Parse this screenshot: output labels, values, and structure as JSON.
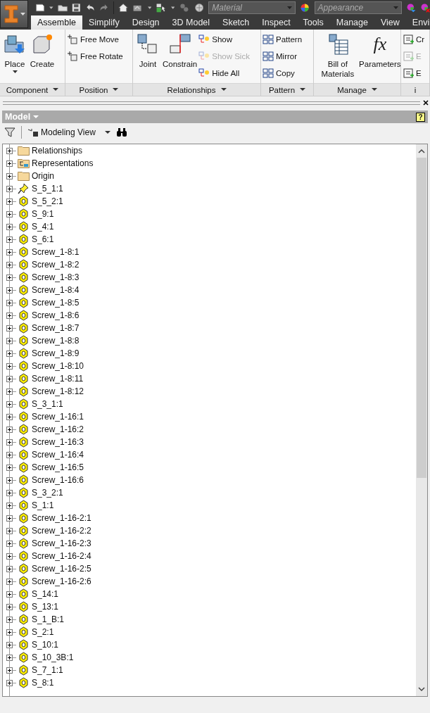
{
  "quick_access": {
    "material_placeholder": "Material",
    "appearance_placeholder": "Appearance"
  },
  "tabs": [
    {
      "label": "Assemble",
      "selected": true
    },
    {
      "label": "Simplify",
      "selected": false
    },
    {
      "label": "Design",
      "selected": false
    },
    {
      "label": "3D Model",
      "selected": false
    },
    {
      "label": "Sketch",
      "selected": false
    },
    {
      "label": "Inspect",
      "selected": false
    },
    {
      "label": "Tools",
      "selected": false
    },
    {
      "label": "Manage",
      "selected": false
    },
    {
      "label": "View",
      "selected": false
    },
    {
      "label": "Envi",
      "selected": false
    }
  ],
  "ribbon": {
    "panels": [
      {
        "label": "Component",
        "menu": true,
        "tools": [
          {
            "label": "Place",
            "kind": "split",
            "disabled": false
          },
          {
            "label": "Create",
            "kind": "large",
            "disabled": false
          }
        ]
      },
      {
        "label": "Position",
        "menu": true,
        "tools": [
          {
            "label": "Free Move",
            "kind": "small",
            "disabled": false
          },
          {
            "label": "Free Rotate",
            "kind": "small",
            "disabled": false
          }
        ]
      },
      {
        "label": "Relationships",
        "menu": true,
        "tools": [
          {
            "label": "Joint",
            "kind": "large",
            "disabled": false
          },
          {
            "label": "Constrain",
            "kind": "large",
            "disabled": false
          },
          {
            "label": "Show",
            "kind": "small",
            "disabled": false
          },
          {
            "label": "Show Sick",
            "kind": "small",
            "disabled": true
          },
          {
            "label": "Hide All",
            "kind": "small",
            "disabled": false
          }
        ]
      },
      {
        "label": "Pattern",
        "menu": true,
        "tools": [
          {
            "label": "Pattern",
            "kind": "small",
            "disabled": false
          },
          {
            "label": "Mirror",
            "kind": "small",
            "disabled": false
          },
          {
            "label": "Copy",
            "kind": "small",
            "disabled": false
          }
        ]
      },
      {
        "label": "Manage",
        "menu": true,
        "tools": [
          {
            "label": "Bill of Materials",
            "kind": "large",
            "disabled": false
          },
          {
            "label": "Parameters",
            "kind": "large",
            "disabled": false,
            "icon_text": "fx"
          }
        ]
      },
      {
        "label": "i",
        "menu": false,
        "tools": [
          {
            "label": "Cr",
            "kind": "small",
            "disabled": false
          },
          {
            "label": "E",
            "kind": "small",
            "disabled": true
          },
          {
            "label": "E",
            "kind": "small",
            "disabled": false
          }
        ]
      }
    ]
  },
  "browser": {
    "title": "Model",
    "help_text": "?",
    "view": "Modeling View",
    "items": [
      {
        "label": "Relationships",
        "kind": "folder"
      },
      {
        "label": "Representations",
        "kind": "representations"
      },
      {
        "label": "Origin",
        "kind": "folder"
      },
      {
        "label": "S_5_1:1",
        "kind": "grounded"
      },
      {
        "label": "S_5_2:1",
        "kind": "part"
      },
      {
        "label": "S_9:1",
        "kind": "part"
      },
      {
        "label": "S_4:1",
        "kind": "part"
      },
      {
        "label": "S_6:1",
        "kind": "part"
      },
      {
        "label": "Screw_1-8:1",
        "kind": "part"
      },
      {
        "label": "Screw_1-8:2",
        "kind": "part"
      },
      {
        "label": "Screw_1-8:3",
        "kind": "part"
      },
      {
        "label": "Screw_1-8:4",
        "kind": "part"
      },
      {
        "label": "Screw_1-8:5",
        "kind": "part"
      },
      {
        "label": "Screw_1-8:6",
        "kind": "part"
      },
      {
        "label": "Screw_1-8:7",
        "kind": "part"
      },
      {
        "label": "Screw_1-8:8",
        "kind": "part"
      },
      {
        "label": "Screw_1-8:9",
        "kind": "part"
      },
      {
        "label": "Screw_1-8:10",
        "kind": "part"
      },
      {
        "label": "Screw_1-8:11",
        "kind": "part"
      },
      {
        "label": "Screw_1-8:12",
        "kind": "part"
      },
      {
        "label": "S_3_1:1",
        "kind": "part"
      },
      {
        "label": "Screw_1-16:1",
        "kind": "part"
      },
      {
        "label": "Screw_1-16:2",
        "kind": "part"
      },
      {
        "label": "Screw_1-16:3",
        "kind": "part"
      },
      {
        "label": "Screw_1-16:4",
        "kind": "part"
      },
      {
        "label": "Screw_1-16:5",
        "kind": "part"
      },
      {
        "label": "Screw_1-16:6",
        "kind": "part"
      },
      {
        "label": "S_3_2:1",
        "kind": "part"
      },
      {
        "label": "S_1:1",
        "kind": "part"
      },
      {
        "label": "Screw_1-16-2:1",
        "kind": "part"
      },
      {
        "label": "Screw_1-16-2:2",
        "kind": "part"
      },
      {
        "label": "Screw_1-16-2:3",
        "kind": "part"
      },
      {
        "label": "Screw_1-16-2:4",
        "kind": "part"
      },
      {
        "label": "Screw_1-16-2:5",
        "kind": "part"
      },
      {
        "label": "Screw_1-16-2:6",
        "kind": "part"
      },
      {
        "label": "S_14:1",
        "kind": "part"
      },
      {
        "label": "S_13:1",
        "kind": "part"
      },
      {
        "label": "S_1_B:1",
        "kind": "part"
      },
      {
        "label": "S_2:1",
        "kind": "part"
      },
      {
        "label": "S_10:1",
        "kind": "part"
      },
      {
        "label": "S_10_3B:1",
        "kind": "part"
      },
      {
        "label": "S_7_1:1",
        "kind": "part"
      },
      {
        "label": "S_8:1",
        "kind": "part"
      }
    ]
  }
}
